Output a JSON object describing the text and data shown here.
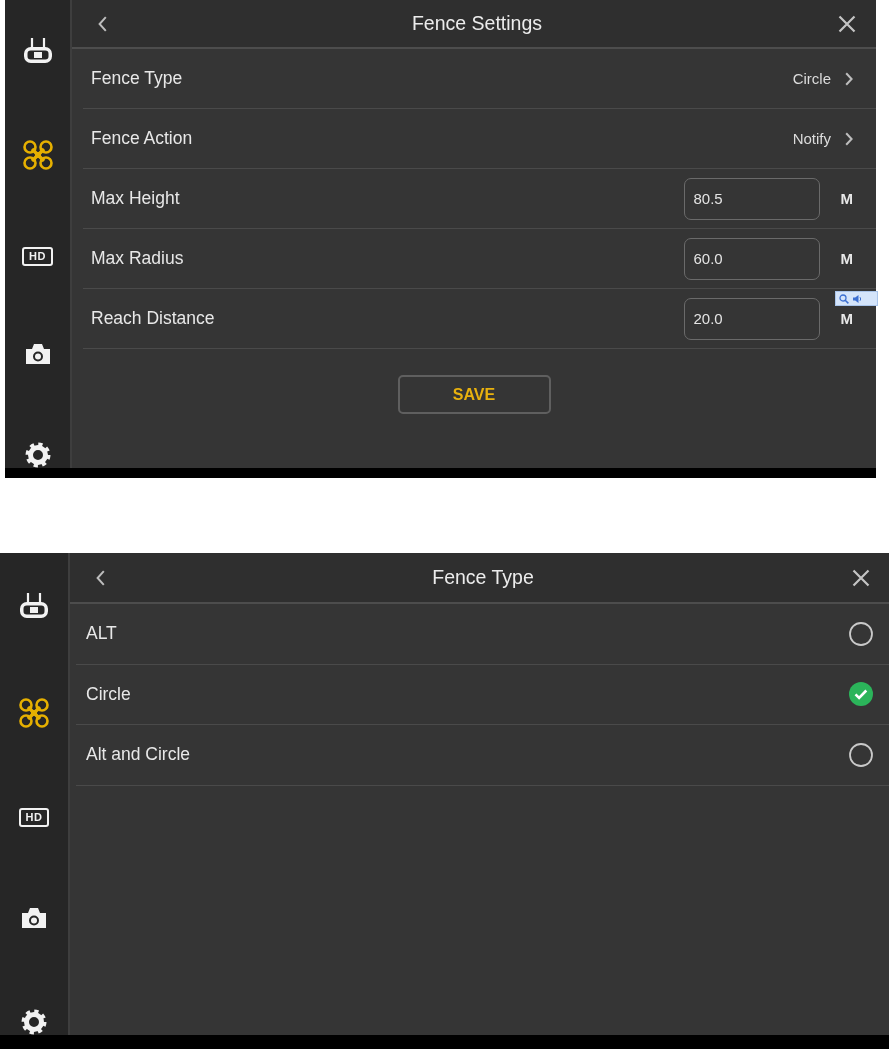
{
  "screens": [
    {
      "title": "Fence Settings",
      "sidebar": {
        "items": [
          {
            "kind": "remote",
            "selected": false
          },
          {
            "kind": "drone",
            "selected": true
          },
          {
            "kind": "hd",
            "label": "HD",
            "selected": false
          },
          {
            "kind": "camera",
            "selected": false
          },
          {
            "kind": "settings",
            "selected": false
          }
        ]
      },
      "rows": [
        {
          "kind": "select",
          "label": "Fence Type",
          "value": "Circle"
        },
        {
          "kind": "select",
          "label": "Fence Action",
          "value": "Notify"
        },
        {
          "kind": "number",
          "label": "Max Height",
          "value": "80.5",
          "unit": "M"
        },
        {
          "kind": "number",
          "label": "Max Radius",
          "value": "60.0",
          "unit": "M"
        },
        {
          "kind": "number",
          "label": "Reach Distance",
          "value": "20.0",
          "unit": "M"
        }
      ],
      "save_button": {
        "label": "SAVE"
      },
      "floating_toolbar": true
    },
    {
      "title": "Fence Type",
      "sidebar": {
        "items": [
          {
            "kind": "remote",
            "selected": false
          },
          {
            "kind": "drone",
            "selected": true
          },
          {
            "kind": "hd",
            "label": "HD",
            "selected": false
          },
          {
            "kind": "camera",
            "selected": false
          },
          {
            "kind": "settings",
            "selected": false
          }
        ]
      },
      "options": [
        {
          "label": "ALT",
          "selected": false
        },
        {
          "label": "Circle",
          "selected": true
        },
        {
          "label": "Alt and Circle",
          "selected": false
        }
      ]
    }
  ]
}
